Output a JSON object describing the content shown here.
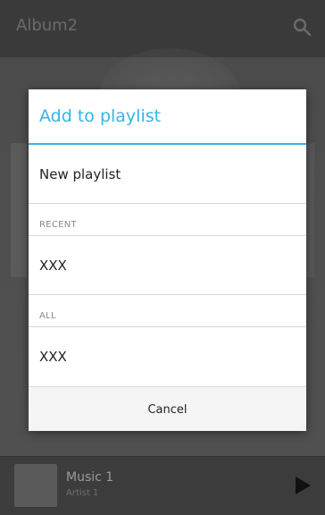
{
  "app_bar": {
    "title": "Album2",
    "search_icon": "search-icon"
  },
  "now_playing": {
    "title": "Music 1",
    "artist": "Artist 1",
    "play_icon": "play-icon"
  },
  "dialog": {
    "title": "Add to playlist",
    "new_playlist_label": "New playlist",
    "sections": [
      {
        "header": "RECENT",
        "items": [
          "XXX"
        ]
      },
      {
        "header": "ALL",
        "items": [
          "XXX"
        ]
      }
    ],
    "cancel_label": "Cancel",
    "accent_color": "#33b5e5"
  }
}
